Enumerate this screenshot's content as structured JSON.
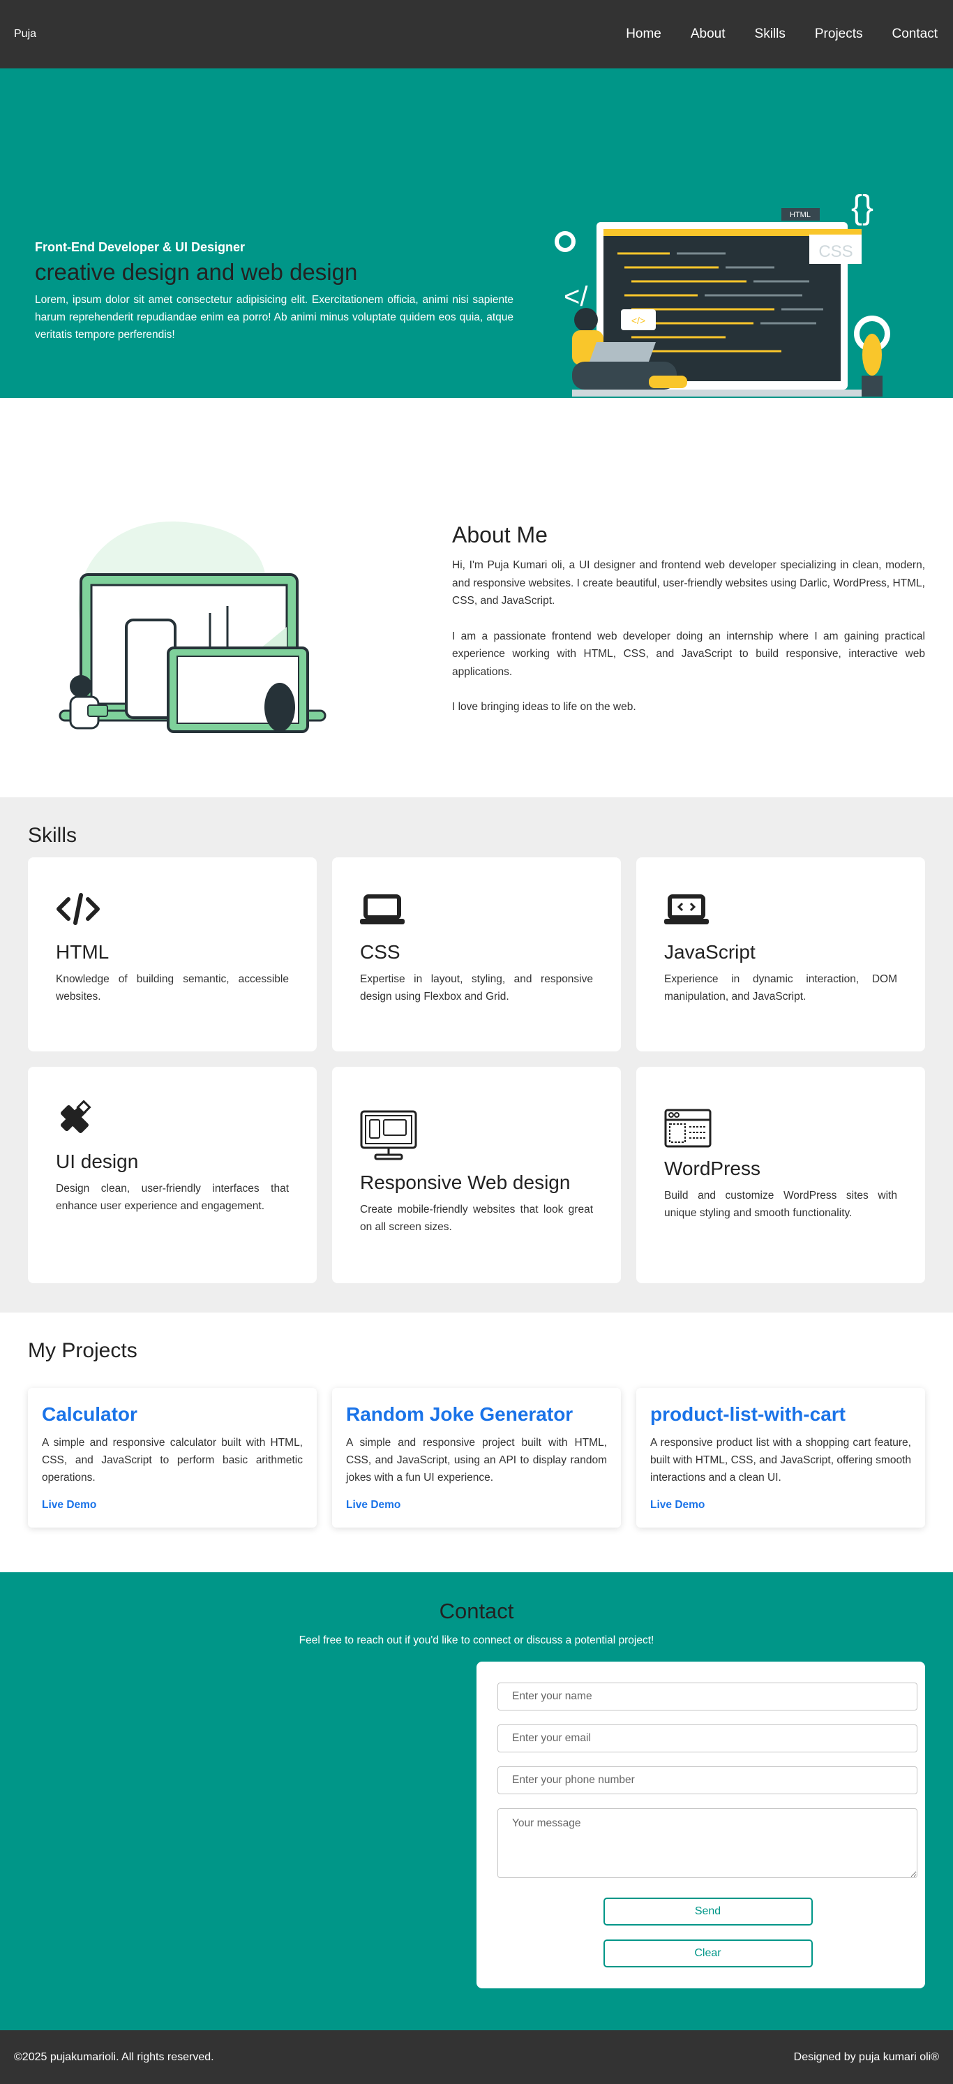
{
  "nav": {
    "brand": "Puja",
    "links": [
      "Home",
      "About",
      "Skills",
      "Projects",
      "Contact"
    ]
  },
  "hero": {
    "subtitle": "Front-End Developer & UI Designer",
    "title": "creative design and web design",
    "description": "Lorem, ipsum dolor sit amet consectetur adipisicing elit. Exercitationem officia, animi nisi sapiente harum reprehenderit repudiandae enim ea porro! Ab animi minus voluptate quidem eos quia, atque veritatis tempore perferendis!",
    "illustration_labels": [
      "HTML",
      "CSS"
    ]
  },
  "about": {
    "title": "About Me",
    "paragraphs": [
      "Hi, I'm Puja Kumari oli, a UI designer and frontend web developer specializing in clean, modern, and responsive websites. I create beautiful, user-friendly websites using Darlic, WordPress, HTML, CSS, and JavaScript.",
      "I am a passionate frontend web developer doing an internship where I am gaining practical experience working with HTML, CSS, and JavaScript to build responsive, interactive web applications.",
      "I love bringing ideas to life on the web."
    ]
  },
  "skills": {
    "title": "Skills",
    "items": [
      {
        "icon": "code-icon",
        "name": "HTML",
        "desc": "Knowledge of building semantic, accessible websites."
      },
      {
        "icon": "laptop-icon",
        "name": "CSS",
        "desc": "Expertise in layout, styling, and responsive design using Flexbox and Grid."
      },
      {
        "icon": "laptop-code-icon",
        "name": "JavaScript",
        "desc": "Experience in dynamic interaction, DOM manipulation, and JavaScript."
      },
      {
        "icon": "pencil-ruler-icon",
        "name": "UI design",
        "desc": "Design clean, user-friendly interfaces that enhance user experience and engagement."
      },
      {
        "icon": "responsive-devices-icon",
        "name": "Responsive Web design",
        "desc": "Create mobile-friendly websites that look great on all screen sizes."
      },
      {
        "icon": "browser-window-icon",
        "name": "WordPress",
        "desc": "Build and customize WordPress sites with unique styling and smooth functionality."
      }
    ]
  },
  "projects": {
    "title": "My Projects",
    "items": [
      {
        "title": "Calculator",
        "desc": "A simple and responsive calculator built with HTML, CSS, and JavaScript to perform basic arithmetic operations.",
        "link": "Live Demo"
      },
      {
        "title": "Random Joke Generator",
        "desc": "A simple and responsive project built with HTML, CSS, and JavaScript, using an API to display random jokes with a fun UI experience.",
        "link": "Live Demo"
      },
      {
        "title": "product-list-with-cart",
        "desc": "A responsive product list with a shopping cart feature, built with HTML, CSS, and JavaScript, offering smooth interactions and a clean UI.",
        "link": "Live Demo"
      }
    ]
  },
  "contact": {
    "title": "Contact",
    "subtitle": "Feel free to reach out if you'd like to connect or discuss a potential project!",
    "name_placeholder": "Enter your name",
    "email_placeholder": "Enter your email",
    "phone_placeholder": "Enter your phone number",
    "message_placeholder": "Your message",
    "send_label": "Send",
    "clear_label": "Clear"
  },
  "footer": {
    "copyright": "©2025 pujakumarioli. All rights reserved.",
    "credit": "Designed by puja kumari oli®"
  },
  "colors": {
    "teal": "#009688",
    "dark": "#333333",
    "link_blue": "#1a73e8",
    "light_gray": "#eeeeee"
  }
}
